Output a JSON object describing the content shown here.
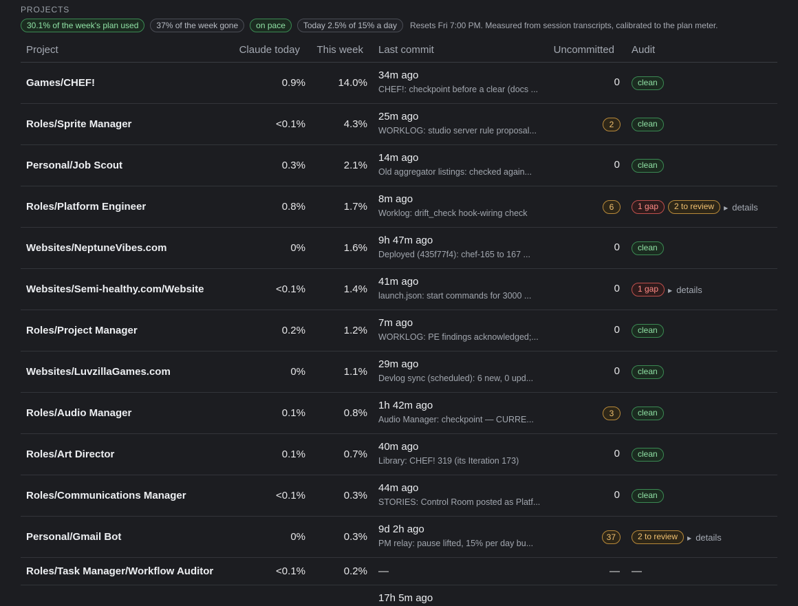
{
  "section_title": "PROJECTS",
  "summary": {
    "plan_used": "30.1% of the week's plan used",
    "week_gone": "37% of the week gone",
    "pace": "on pace",
    "today": "Today 2.5% of 15% a day",
    "note": "Resets Fri 7:00 PM. Measured from session transcripts, calibrated to the plan meter."
  },
  "columns": {
    "project": "Project",
    "today": "Claude today",
    "week": "This week",
    "commit": "Last commit",
    "uncommitted": "Uncommitted",
    "audit": "Audit"
  },
  "rows": [
    {
      "project": "Games/CHEF!",
      "today": "0.9%",
      "week": "14.0%",
      "commit_time": "34m ago",
      "commit_msg": "CHEF!: checkpoint before a clear (docs ...",
      "uncommitted": "0",
      "uncommitted_badge": false,
      "audit": [
        {
          "kind": "clean",
          "label": "clean"
        }
      ],
      "details": ""
    },
    {
      "project": "Roles/Sprite Manager",
      "today": "<0.1%",
      "week": "4.3%",
      "commit_time": "25m ago",
      "commit_msg": "WORKLOG: studio server rule proposal...",
      "uncommitted": "2",
      "uncommitted_badge": true,
      "audit": [
        {
          "kind": "clean",
          "label": "clean"
        }
      ],
      "details": ""
    },
    {
      "project": "Personal/Job Scout",
      "today": "0.3%",
      "week": "2.1%",
      "commit_time": "14m ago",
      "commit_msg": "Old aggregator listings: checked again...",
      "uncommitted": "0",
      "uncommitted_badge": false,
      "audit": [
        {
          "kind": "clean",
          "label": "clean"
        }
      ],
      "details": ""
    },
    {
      "project": "Roles/Platform Engineer",
      "today": "0.8%",
      "week": "1.7%",
      "commit_time": "8m ago",
      "commit_msg": "Worklog: drift_check hook-wiring check",
      "uncommitted": "6",
      "uncommitted_badge": true,
      "audit": [
        {
          "kind": "gap",
          "label": "1 gap"
        },
        {
          "kind": "review",
          "label": "2 to review"
        }
      ],
      "details": "details"
    },
    {
      "project": "Websites/NeptuneVibes.com",
      "today": "0%",
      "week": "1.6%",
      "commit_time": "9h 47m ago",
      "commit_msg": "Deployed (435f77f4): chef-165 to 167 ...",
      "uncommitted": "0",
      "uncommitted_badge": false,
      "audit": [
        {
          "kind": "clean",
          "label": "clean"
        }
      ],
      "details": ""
    },
    {
      "project": "Websites/Semi-healthy.com/Website",
      "today": "<0.1%",
      "week": "1.4%",
      "commit_time": "41m ago",
      "commit_msg": "launch.json: start commands for 3000 ...",
      "uncommitted": "0",
      "uncommitted_badge": false,
      "audit": [
        {
          "kind": "gap",
          "label": "1 gap"
        }
      ],
      "details": "details"
    },
    {
      "project": "Roles/Project Manager",
      "today": "0.2%",
      "week": "1.2%",
      "commit_time": "7m ago",
      "commit_msg": "WORKLOG: PE findings acknowledged;...",
      "uncommitted": "0",
      "uncommitted_badge": false,
      "audit": [
        {
          "kind": "clean",
          "label": "clean"
        }
      ],
      "details": ""
    },
    {
      "project": "Websites/LuvzillaGames.com",
      "today": "0%",
      "week": "1.1%",
      "commit_time": "29m ago",
      "commit_msg": "Devlog sync (scheduled): 6 new, 0 upd...",
      "uncommitted": "0",
      "uncommitted_badge": false,
      "audit": [
        {
          "kind": "clean",
          "label": "clean"
        }
      ],
      "details": ""
    },
    {
      "project": "Roles/Audio Manager",
      "today": "0.1%",
      "week": "0.8%",
      "commit_time": "1h 42m ago",
      "commit_msg": "Audio Manager: checkpoint — CURRE...",
      "uncommitted": "3",
      "uncommitted_badge": true,
      "audit": [
        {
          "kind": "clean",
          "label": "clean"
        }
      ],
      "details": ""
    },
    {
      "project": "Roles/Art Director",
      "today": "0.1%",
      "week": "0.7%",
      "commit_time": "40m ago",
      "commit_msg": "Library: CHEF! 319 (its Iteration 173)",
      "uncommitted": "0",
      "uncommitted_badge": false,
      "audit": [
        {
          "kind": "clean",
          "label": "clean"
        }
      ],
      "details": ""
    },
    {
      "project": "Roles/Communications Manager",
      "today": "<0.1%",
      "week": "0.3%",
      "commit_time": "44m ago",
      "commit_msg": "STORIES: Control Room posted as Platf...",
      "uncommitted": "0",
      "uncommitted_badge": false,
      "audit": [
        {
          "kind": "clean",
          "label": "clean"
        }
      ],
      "details": ""
    },
    {
      "project": "Personal/Gmail Bot",
      "today": "0%",
      "week": "0.3%",
      "commit_time": "9d 2h ago",
      "commit_msg": "PM relay: pause lifted, 15% per day bu...",
      "uncommitted": "37",
      "uncommitted_badge": true,
      "audit": [
        {
          "kind": "review",
          "label": "2 to review"
        }
      ],
      "details": "details"
    }
  ],
  "last_row": {
    "project": "Roles/Task Manager/Workflow Auditor",
    "today": "<0.1%",
    "week": "0.2%",
    "commit": "—",
    "uncommitted": "—",
    "audit": "—"
  },
  "peek_row": {
    "commit_time": "17h 5m ago"
  }
}
